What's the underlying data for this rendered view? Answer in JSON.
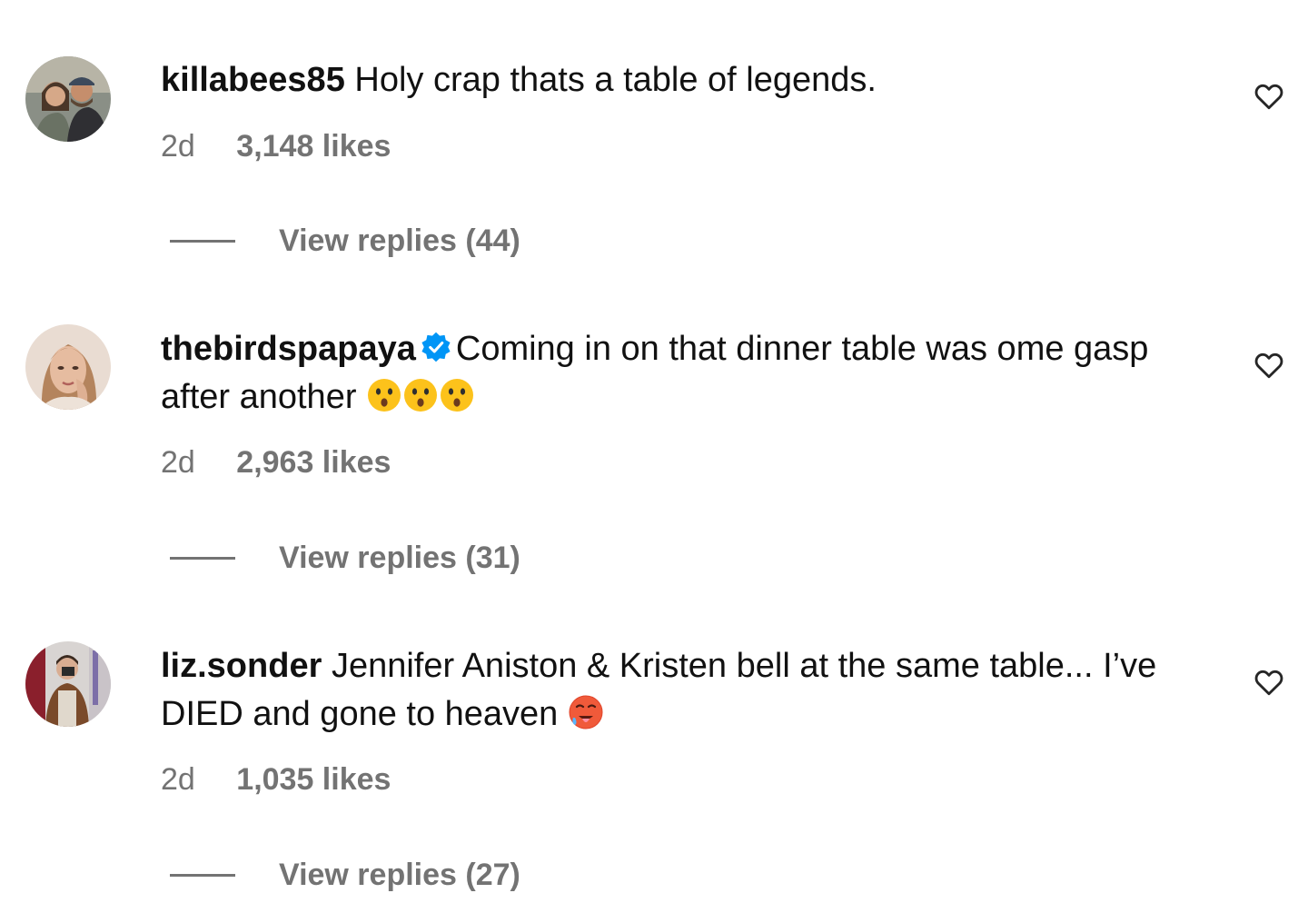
{
  "comments": [
    {
      "username": "killabees85",
      "verified": false,
      "text": "Holy crap thats a table of legends.",
      "emojis": [],
      "time": "2d",
      "likes": "3,148 likes",
      "replies": "View replies (44)",
      "like_icon": "heart-outline-icon"
    },
    {
      "username": "thebirdspapaya",
      "verified": true,
      "text": "Coming in on that dinner table was ome gasp after another",
      "emojis": [
        "astonished-face",
        "astonished-face",
        "astonished-face"
      ],
      "time": "2d",
      "likes": "2,963 likes",
      "replies": "View replies (31)",
      "like_icon": "heart-outline-icon"
    },
    {
      "username": "liz.sonder",
      "verified": false,
      "text": "Jennifer Aniston & Kristen bell at the same table... I’ve DIED and gone to heaven",
      "emojis": [
        "hot-face"
      ],
      "time": "2d",
      "likes": "1,035 likes",
      "replies": "View replies (27)",
      "like_icon": "heart-outline-icon"
    }
  ],
  "colors": {
    "text": "#111111",
    "muted": "#737373",
    "verified_blue": "#0095f6",
    "background": "#ffffff"
  }
}
